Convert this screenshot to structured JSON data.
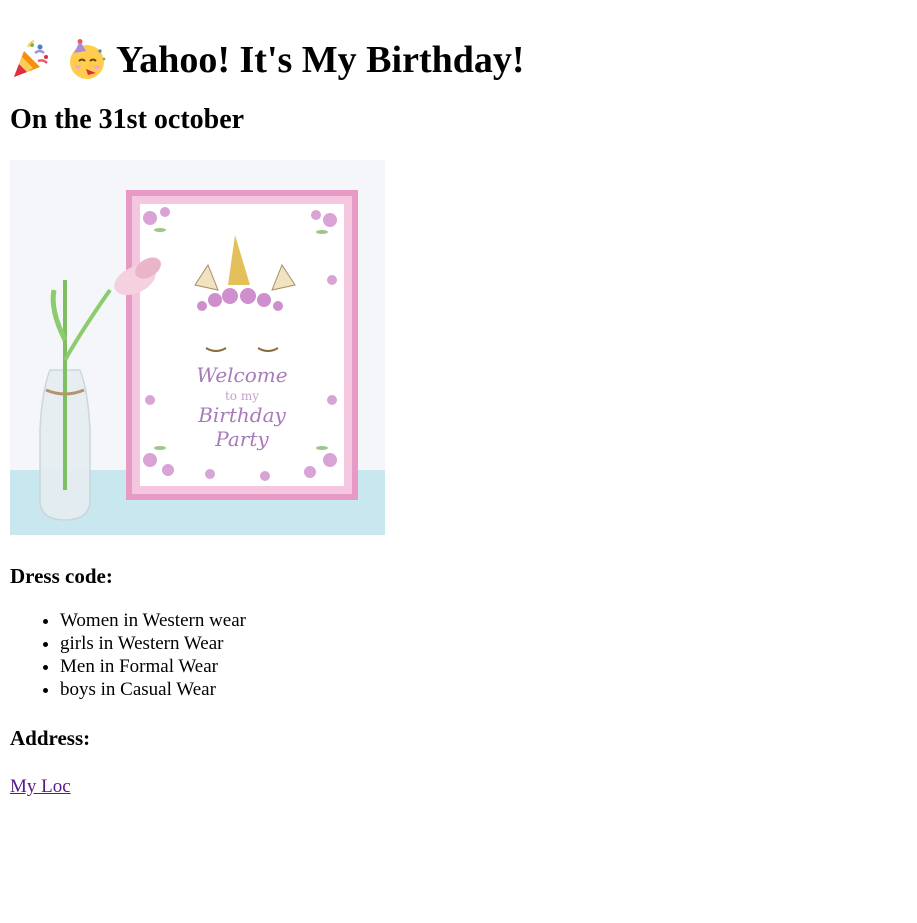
{
  "header": {
    "title": "Yahoo! It's My Birthday!",
    "icons": [
      "party-popper-icon",
      "partying-face-icon"
    ]
  },
  "subtitle": "On the 31st october",
  "image": {
    "frame_text_line1": "Welcome",
    "frame_text_line2": "to my",
    "frame_text_line3": "Birthday",
    "frame_text_line4": "Party"
  },
  "dress_code": {
    "heading": "Dress code:",
    "items": [
      "Women in Western wear",
      "girls in Western Wear",
      "Men in Formal Wear",
      "boys in Casual Wear"
    ]
  },
  "address": {
    "heading": "Address:",
    "link_text": "My Loc"
  },
  "colors": {
    "link": "#551a8b",
    "frame": "#e79bc4"
  }
}
